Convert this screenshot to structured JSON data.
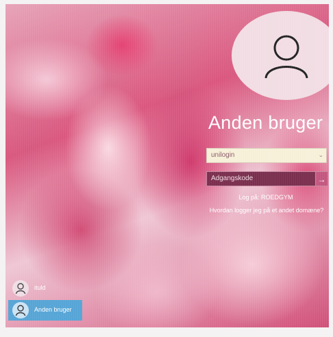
{
  "login": {
    "username": "Anden bruger",
    "username_field_value": "unilogin",
    "password_placeholder": "Adgangskode",
    "logon_to": "Log på: ROEDGYM",
    "other_domain_link": "Hvordan logger jeg på et andet domæne?"
  },
  "icons": {
    "avatar": "user-icon",
    "dropdown": "chevron-down-icon",
    "submit": "arrow-right-icon"
  },
  "user_switcher": {
    "items": [
      {
        "label": "ituld",
        "selected": false
      },
      {
        "label": "Anden bruger",
        "selected": true
      }
    ]
  },
  "colors": {
    "selected_user": "#56a5d6",
    "password_field": "#7a2f4e",
    "username_field": "#f7f0d9"
  }
}
